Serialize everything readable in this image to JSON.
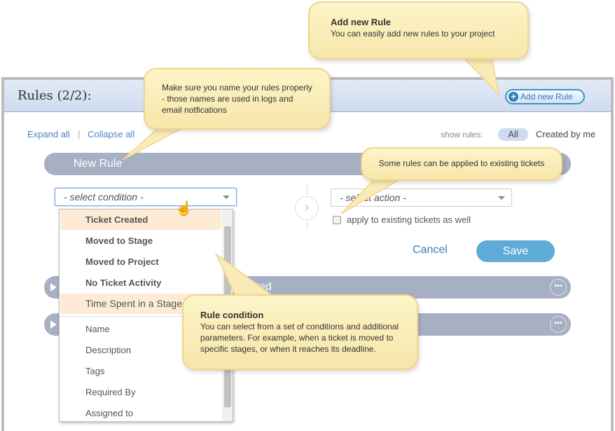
{
  "header": {
    "title": "Rules (2/2):",
    "add_button": "Add new Rule"
  },
  "toolbar": {
    "expand_all": "Expand all",
    "separator": "|",
    "collapse_all": "Collapse all",
    "show_rules_label": "show rules:",
    "filter_all": "All",
    "filter_created_by_me": "Created by me"
  },
  "rules": [
    {
      "name": "New Rule"
    },
    {
      "name": "ompleted"
    },
    {
      "name": ""
    }
  ],
  "editor": {
    "condition_placeholder": "- select condition -",
    "action_placeholder": "- select action -",
    "apply_existing_label": "apply to existing tickets as well",
    "apply_existing_checked": false,
    "cancel": "Cancel",
    "save": "Save"
  },
  "dropdown": {
    "items": [
      {
        "label": "Ticket Created",
        "bold": true,
        "highlighted": true
      },
      {
        "label": "Moved to Stage",
        "bold": true
      },
      {
        "label": "Moved to Project",
        "bold": true
      },
      {
        "label": "No Ticket Activity",
        "bold": true
      },
      {
        "label": "Time Spent in a Stage",
        "bold": false,
        "highlighted": true
      },
      {
        "label": "Name"
      },
      {
        "label": "Description"
      },
      {
        "label": "Tags"
      },
      {
        "label": "Required By"
      },
      {
        "label": "Assigned to"
      }
    ]
  },
  "callouts": {
    "add_rule": {
      "title": "Add new Rule",
      "body": "You can easily add new rules to your project"
    },
    "naming": {
      "body": "Make sure you name your rules properly - those names are used in logs and email notfications"
    },
    "existing": {
      "body": "Some rules can be applied to existing tickets"
    },
    "condition": {
      "title": "Rule condition",
      "body": "You can select from a set of conditions and additional parameters. For example, when a ticket is moved to specific stages, or when it reaches its deadline."
    }
  },
  "colors": {
    "bar": "#a7afc2",
    "save": "#5fabd8",
    "link": "#4a83c4",
    "callout": "#fdf4c8",
    "highlight": "#fdebd6"
  }
}
